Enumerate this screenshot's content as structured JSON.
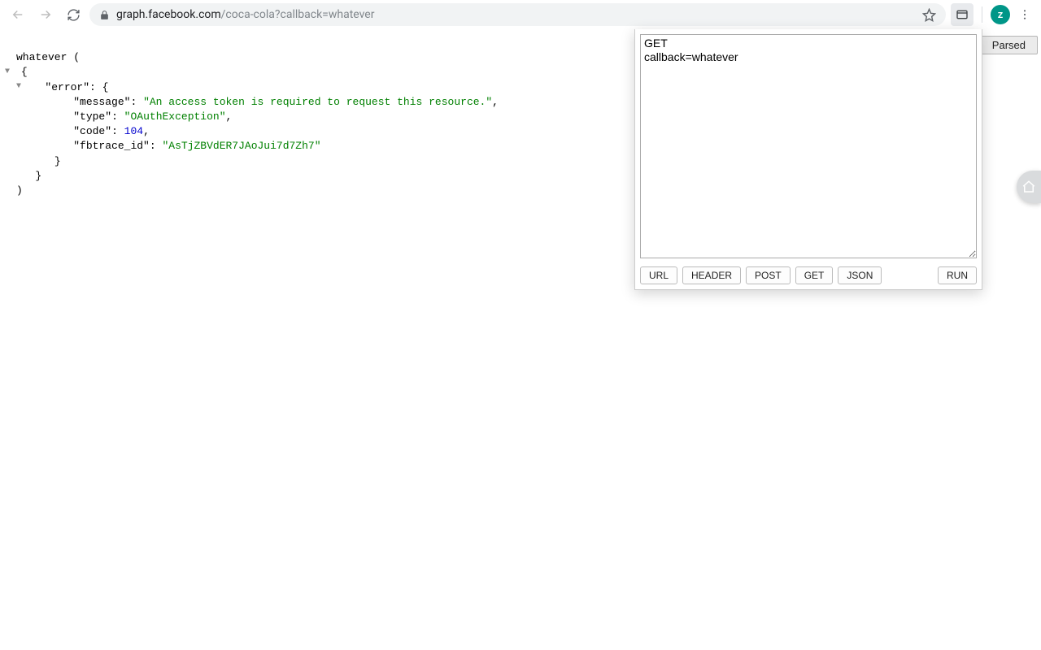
{
  "browser": {
    "url_host": "graph.facebook.com",
    "url_path": "/coca-cola?callback=whatever",
    "avatar_letter": "z"
  },
  "json_view": {
    "callback_prefix": "whatever (",
    "error_key": "error",
    "message_key": "message",
    "message_value": "An access token is required to request this resource.",
    "type_key": "type",
    "type_value": "OAuthException",
    "code_key": "code",
    "code_value": 104,
    "fbtrace_key": "fbtrace_id",
    "fbtrace_value": "AsTjZBVdER7JAoJui7d7Zh7"
  },
  "request_panel": {
    "textarea_value": "GET\ncallback=whatever",
    "buttons": {
      "url": "URL",
      "header": "HEADER",
      "post": "POST",
      "get": "GET",
      "json": "JSON",
      "run": "RUN"
    }
  },
  "toolbar": {
    "parsed_label": "Parsed"
  }
}
